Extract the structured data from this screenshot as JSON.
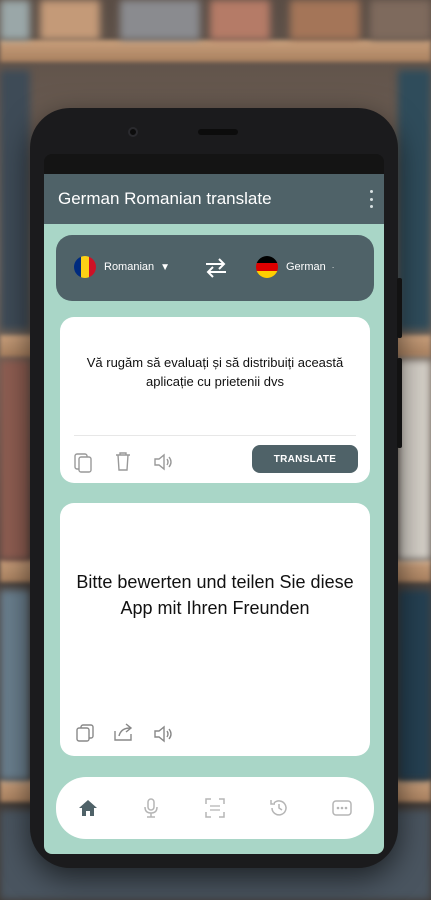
{
  "app": {
    "title": "German Romanian translate",
    "menu_icon": "more-vert-icon"
  },
  "languages": {
    "source": {
      "name": "Romanian",
      "flag": "romania-flag-icon",
      "flag_colors": [
        "#002b7f",
        "#fcd116",
        "#ce1126"
      ]
    },
    "target": {
      "name": "German",
      "flag": "germany-flag-icon",
      "flag_colors": [
        "#000000",
        "#dd0000",
        "#ffce00"
      ]
    },
    "swap_icon": "swap-arrows-icon"
  },
  "source_card": {
    "text": "Vă rugăm să evaluați și să distribuiți această aplicație cu prietenii dvs",
    "icons": [
      "paste-icon",
      "trash-icon",
      "speaker-icon"
    ],
    "translate_label": "TRANSLATE"
  },
  "result_card": {
    "text": "Bitte bewerten und teilen Sie diese App mit Ihren Freunden",
    "icons": [
      "copy-icon",
      "share-icon",
      "speaker-icon"
    ]
  },
  "bottom_nav": {
    "items": [
      "home-icon",
      "microphone-icon",
      "scan-icon",
      "history-icon",
      "more-icon"
    ],
    "active": "home-icon"
  },
  "colors": {
    "primary": "#4f6268",
    "background": "#a9d6c7",
    "card": "#ffffff"
  }
}
